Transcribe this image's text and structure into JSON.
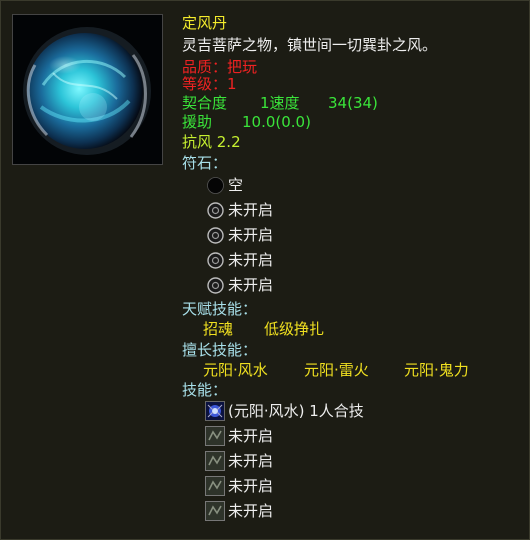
{
  "item": {
    "name": "定风丹",
    "description": "灵吉菩萨之物，镇世间一切巽卦之风。",
    "quality": "品质：把玩",
    "level": "等级：1",
    "fit": {
      "label": "契合度",
      "stat": "1速度",
      "value": "34(34)"
    },
    "assist": {
      "label": "援助",
      "value": "10.0(0.0)"
    },
    "resist_wind": "抗风 2.2"
  },
  "runes": {
    "header": "符石：",
    "slots": [
      "空",
      "未开启",
      "未开启",
      "未开启",
      "未开启"
    ]
  },
  "talent": {
    "header": "天赋技能：",
    "skills": [
      "招魂",
      "低级挣扎"
    ]
  },
  "specialty": {
    "header": "擅长技能：",
    "skills": [
      "元阳·风水",
      "元阳·雷火",
      "元阳·鬼力"
    ]
  },
  "skills": {
    "header": "技能：",
    "items": [
      "(元阳·风水) 1人合技",
      "未开启",
      "未开启",
      "未开启",
      "未开启"
    ]
  },
  "colors": {
    "name": "#f4ec2c",
    "quality": "#ee2222",
    "stat_green": "#3ae43a",
    "lime": "#c6f030",
    "header_cyan": "#a8e0ea",
    "gold": "#f0e020"
  }
}
